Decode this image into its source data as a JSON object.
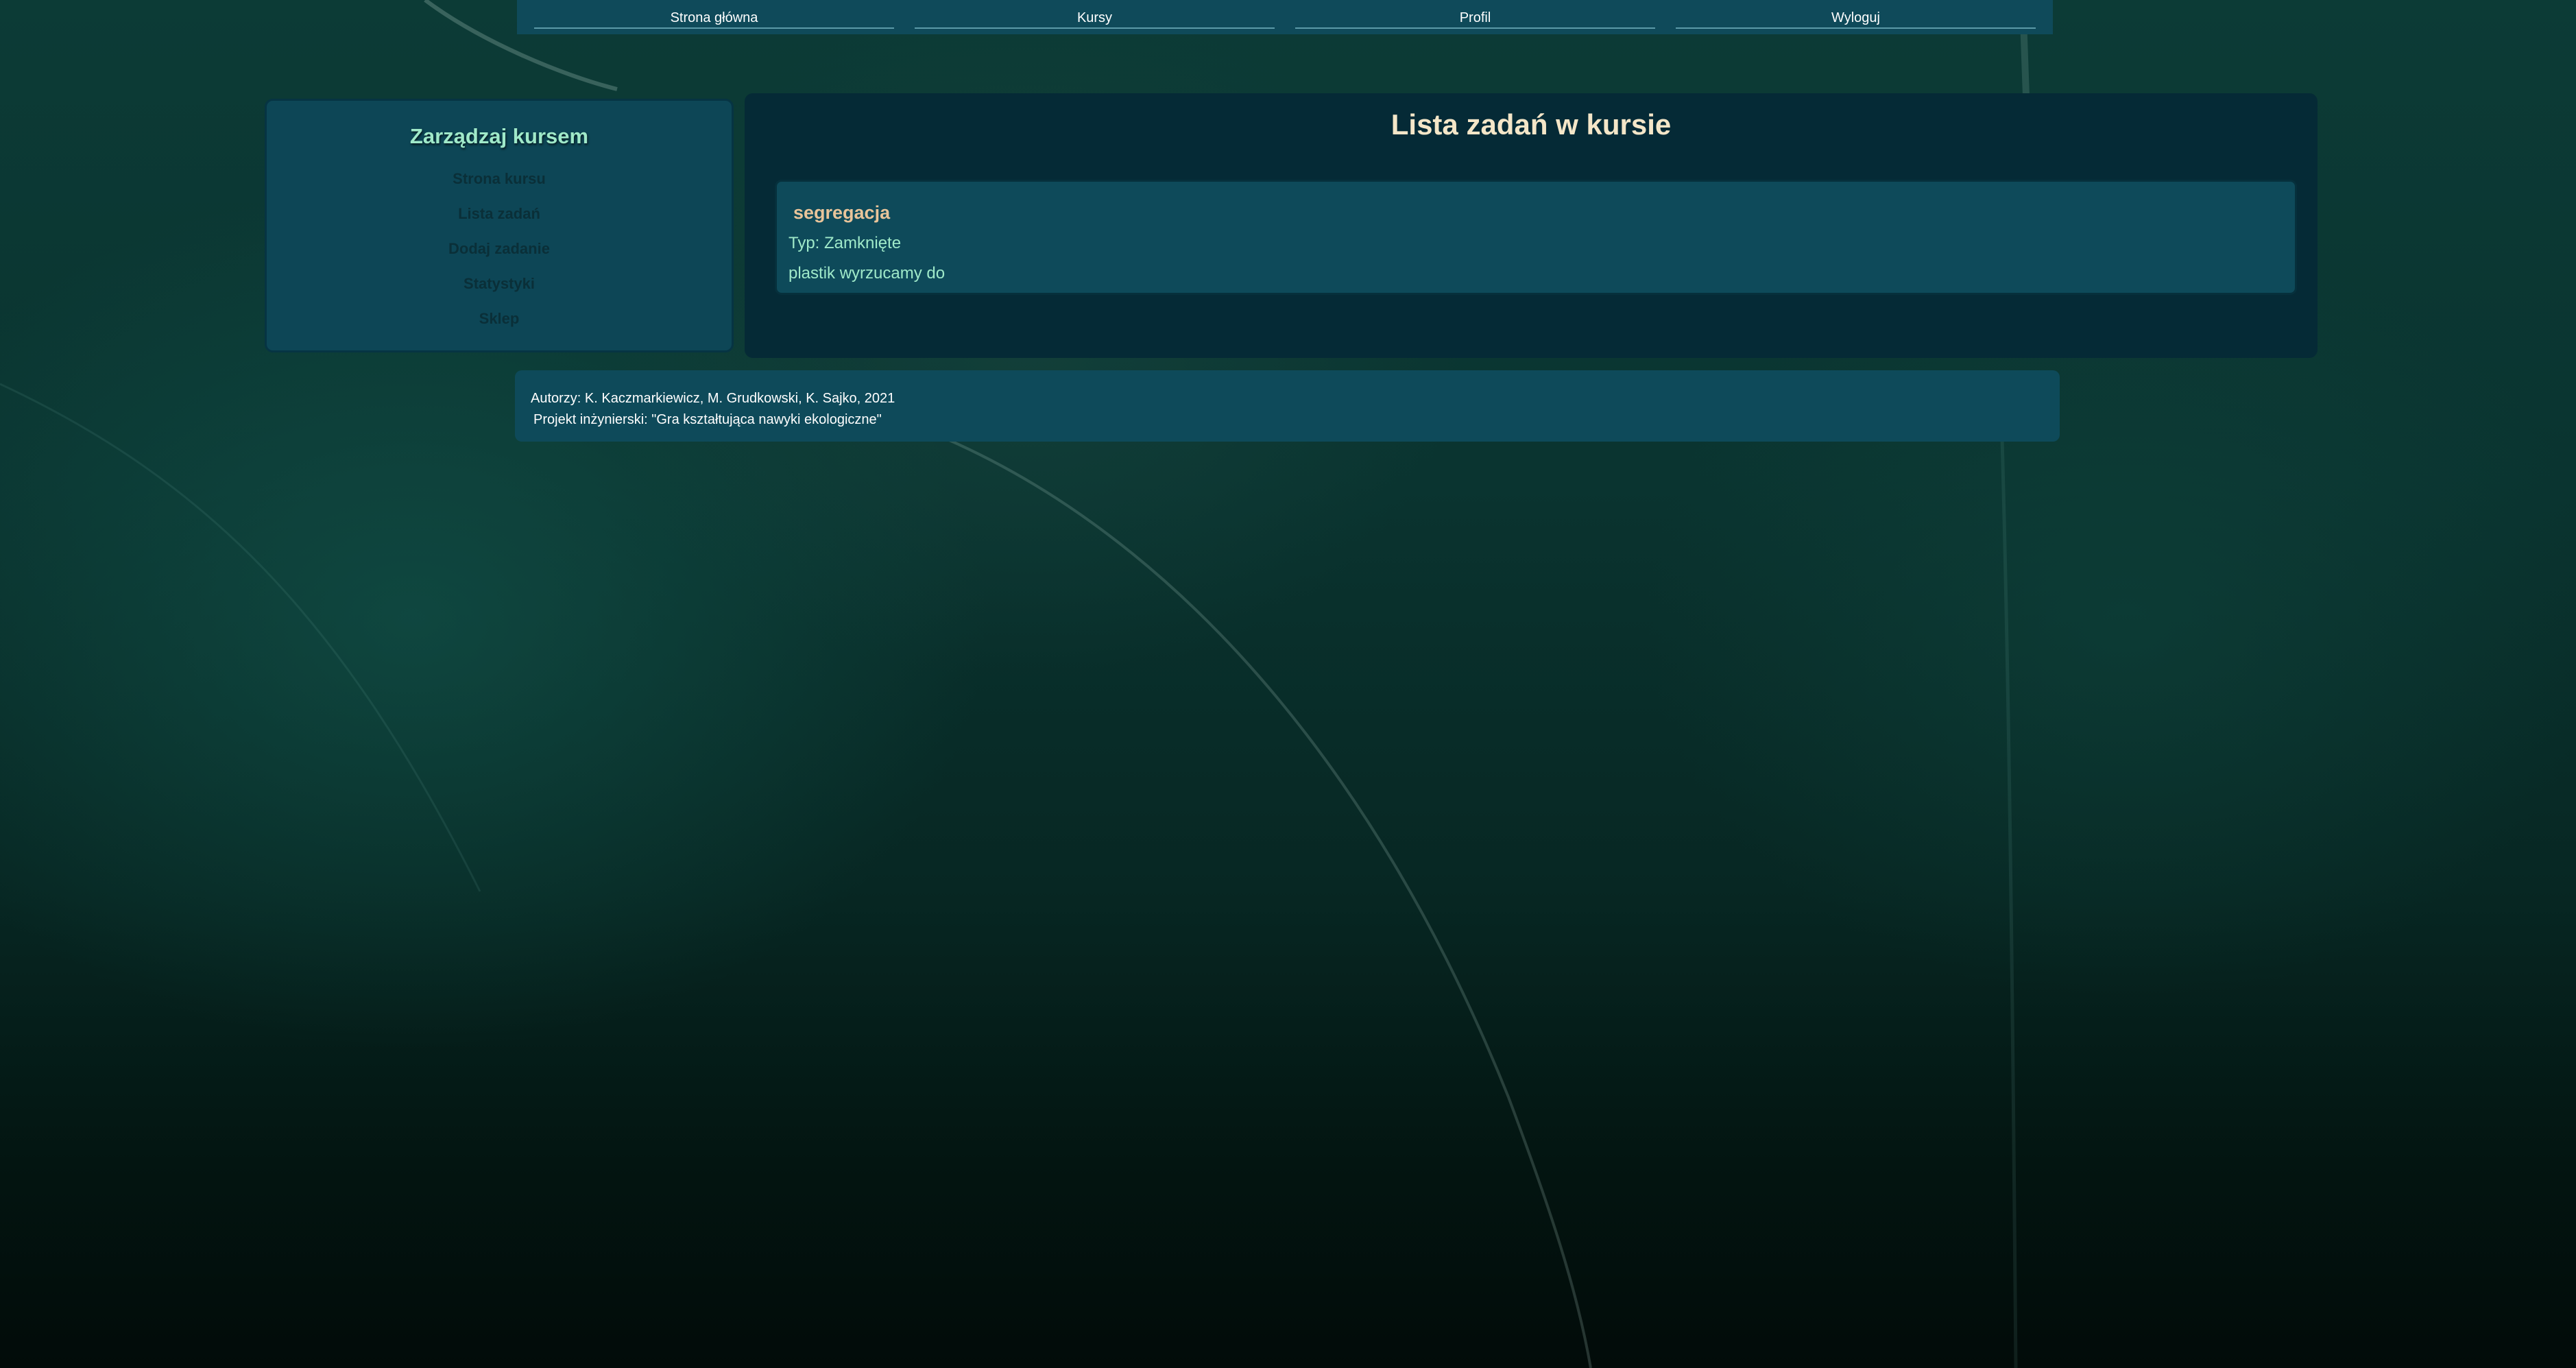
{
  "nav": {
    "items": [
      {
        "label": "Strona główna"
      },
      {
        "label": "Kursy"
      },
      {
        "label": "Profil"
      },
      {
        "label": "Wyloguj"
      }
    ]
  },
  "sidebar": {
    "title": "Zarządzaj kursem",
    "items": [
      {
        "label": "Strona kursu"
      },
      {
        "label": "Lista zadań"
      },
      {
        "label": "Dodaj zadanie"
      },
      {
        "label": "Statystyki"
      },
      {
        "label": "Sklep"
      }
    ]
  },
  "main": {
    "title": "Lista zadań w kursie",
    "tasks": [
      {
        "name": "segregacja",
        "type": "Typ: Zamknięte",
        "description": "plastik wyrzucamy do"
      }
    ]
  },
  "footer": {
    "authors": "Autorzy: K. Kaczmarkiewicz, M. Grudkowski, K. Sajko, 2021",
    "project": "Projekt inżynierski: \"Gra kształtująca nawyki ekologiczne\""
  },
  "colors": {
    "panel": "#0e4a5a",
    "main_panel": "#052a36",
    "accent_green": "#9fe9c9",
    "accent_orange": "#e8c49a",
    "title_cream": "#f4e6c8"
  }
}
